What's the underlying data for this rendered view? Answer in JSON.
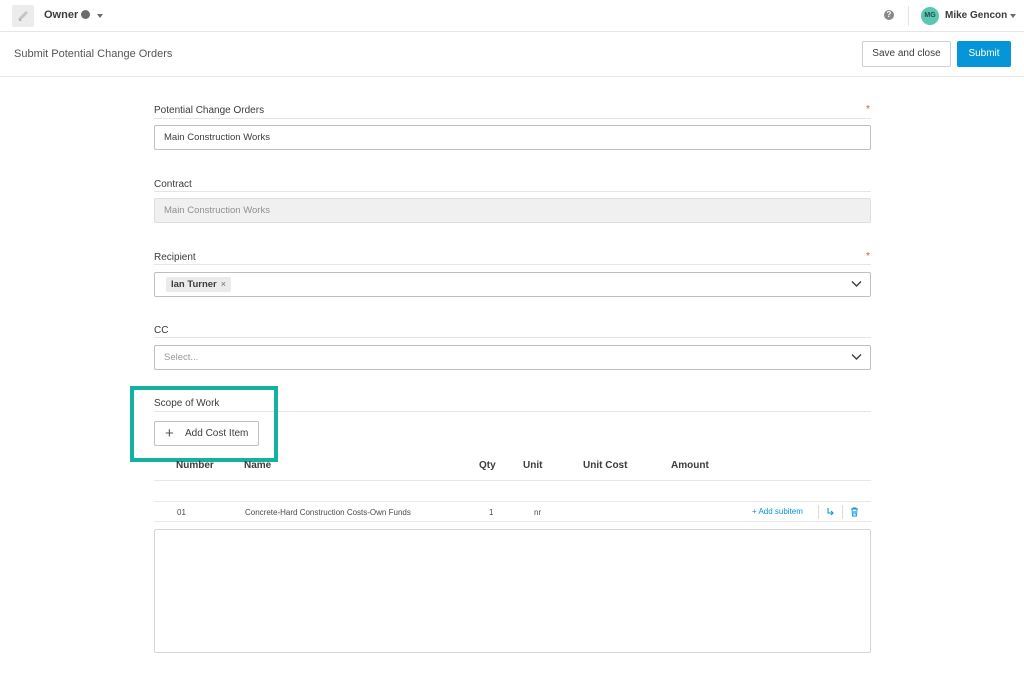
{
  "topbar": {
    "role": "Owner",
    "user_initials": "MG",
    "user_name": "Mike Gencon",
    "help_glyph": "?"
  },
  "header": {
    "title": "Submit Potential Change Orders",
    "save_close_label": "Save and close",
    "submit_label": "Submit",
    "accent_color": "#0696d7"
  },
  "form": {
    "pco": {
      "label": "Potential Change Orders",
      "value": "Main Construction Works",
      "required_mark": "*"
    },
    "contract": {
      "label": "Contract",
      "value": "Main Construction Works"
    },
    "recipient": {
      "label": "Recipient",
      "chip": "Ian Turner",
      "chip_remove": "×",
      "required_mark": "*"
    },
    "cc": {
      "label": "CC",
      "placeholder": "Select..."
    },
    "scope": {
      "label": "Scope of Work",
      "add_button": "Add Cost Item",
      "highlight_color": "#13b2a0"
    }
  },
  "table": {
    "columns": [
      "Number",
      "Name",
      "Qty",
      "Unit",
      "Unit Cost",
      "Amount"
    ],
    "rows": [
      {
        "number": "01",
        "name": "Concrete-Hard Construction Costs-Own Funds",
        "qty": "1",
        "unit": "nr",
        "action": "+ Add subitem"
      }
    ]
  },
  "icons": [
    "app-logo-icon",
    "globe-icon",
    "caret-down-icon",
    "help-icon",
    "chevron-down-icon",
    "plus-icon",
    "indent-icon",
    "trash-icon"
  ]
}
